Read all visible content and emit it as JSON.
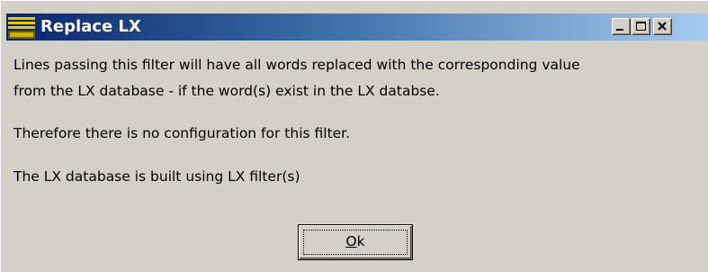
{
  "window": {
    "title": "Replace LX",
    "caption_buttons": {
      "minimize_icon": "minimize-icon",
      "maximize_icon": "maximize-icon",
      "close_icon": "close-icon"
    }
  },
  "message": {
    "line1": "Lines passing this filter will have all words replaced with the corresponding value",
    "line2": "from the LX database - if the word(s) exist in the LX databse.",
    "line3": "Therefore there is no configuration for this filter.",
    "line4": "The LX database is built using LX filter(s)"
  },
  "ok_button": {
    "accel": "O",
    "rest": "k"
  },
  "colors": {
    "titlebar_start": "#0a246a",
    "titlebar_end": "#a6caf0",
    "dialog_bg": "#d4d0c8"
  }
}
